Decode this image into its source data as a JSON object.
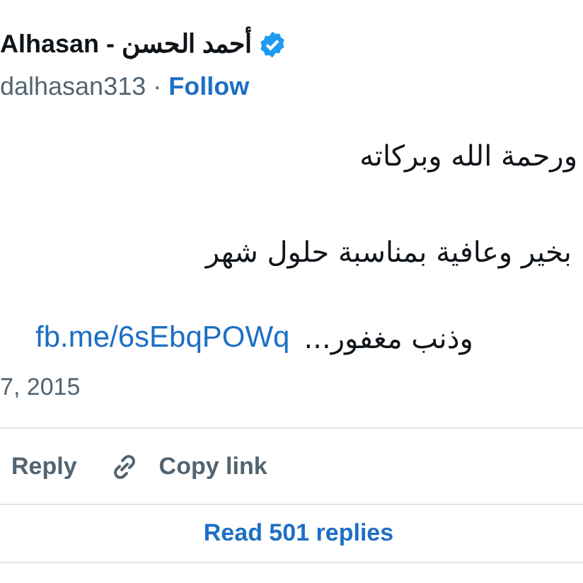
{
  "author": {
    "name": "Alhasan - أحمد الحسن",
    "verified": true,
    "handle": "dalhasan313",
    "separator": "·",
    "follow": "Follow"
  },
  "text_lines": [
    "ورحمة الله وبركاته",
    "بخير وعافية بمناسبة حلول شهر"
  ],
  "last_line": {
    "text": "وذنب مغفور...",
    "link": "fb.me/6sEbqPOWq"
  },
  "date": "7, 2015",
  "reply": "Reply",
  "copy_link": "Copy link",
  "read_replies": "Read 501 replies"
}
